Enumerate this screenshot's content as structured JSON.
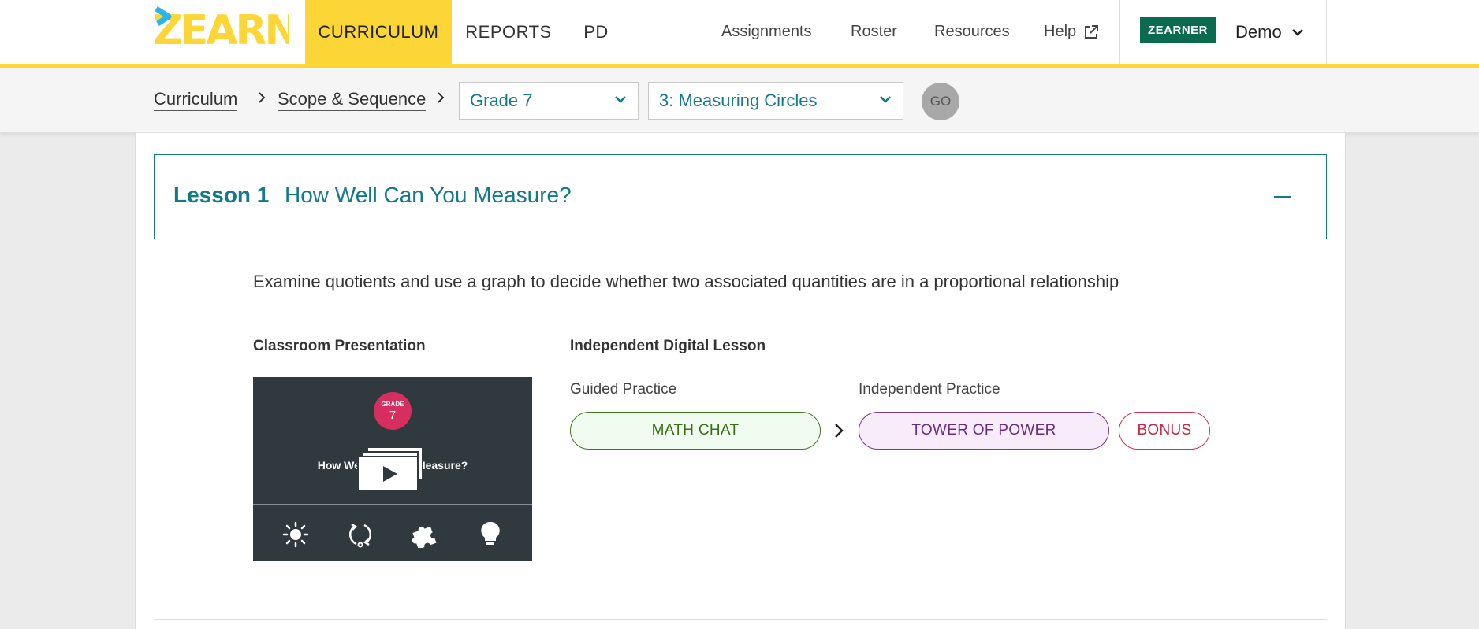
{
  "header": {
    "logo_text": "ZEARN",
    "tabs": [
      {
        "label": "CURRICULUM",
        "active": true
      },
      {
        "label": "REPORTS",
        "active": false
      },
      {
        "label": "PD",
        "active": false
      }
    ],
    "links": [
      {
        "label": "Assignments"
      },
      {
        "label": "Roster"
      },
      {
        "label": "Resources"
      },
      {
        "label": "Help"
      }
    ],
    "badge": "ZEARNER",
    "user": "Demo"
  },
  "subnav": {
    "breadcrumbs": [
      {
        "label": "Curriculum"
      },
      {
        "label": "Scope & Sequence"
      }
    ],
    "grade_select": "Grade 7",
    "unit_select": "3: Measuring Circles",
    "go_label": "GO"
  },
  "lesson": {
    "number": "Lesson 1",
    "title": "How Well Can You Measure?",
    "description": "Examine quotients and use a graph to decide whether two associated quantities are in a proportional relationship",
    "classroom_label": "Classroom Presentation",
    "digital_label": "Independent Digital Lesson",
    "guided_label": "Guided Practice",
    "independent_label": "Independent Practice",
    "video": {
      "grade_word": "GRADE",
      "grade_num": "7",
      "title": "How Well Can You Measure?"
    },
    "pills": {
      "math_chat": "MATH CHAT",
      "tower": "TOWER OF POWER",
      "bonus": "BONUS"
    }
  },
  "colors": {
    "brand_yellow": "#fcd536",
    "teal": "#137a8b",
    "zearner_green": "#0b6b4e"
  }
}
